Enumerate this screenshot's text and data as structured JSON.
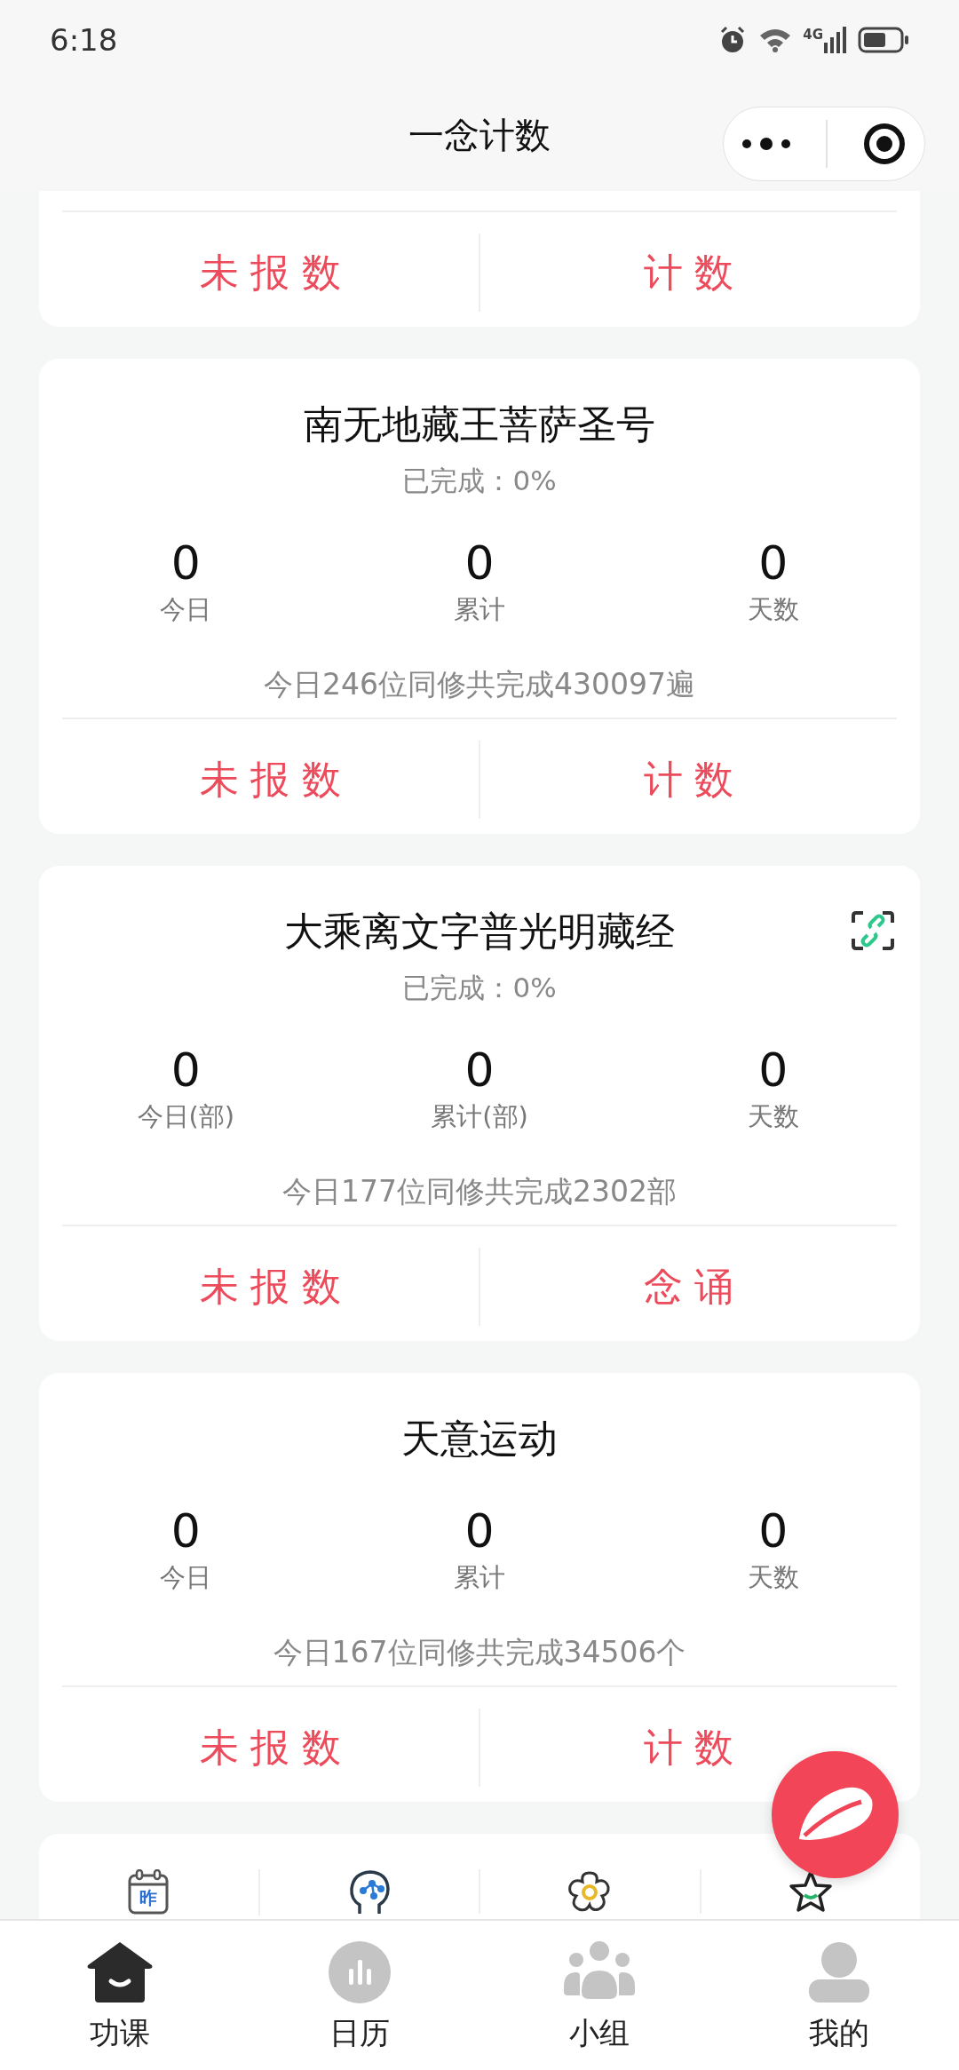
{
  "status_bar": {
    "time": "6:18",
    "network": "4G"
  },
  "header": {
    "title": "一念计数"
  },
  "partial_card": {
    "actions": [
      {
        "label": "未报数"
      },
      {
        "label": "计数"
      }
    ]
  },
  "cards": [
    {
      "title": "南无地藏王菩萨圣号",
      "has_link_icon": false,
      "completed": "已完成：0%",
      "stats": [
        {
          "value": "0",
          "label": "今日"
        },
        {
          "value": "0",
          "label": "累计"
        },
        {
          "value": "0",
          "label": "天数"
        }
      ],
      "community": "今日246位同修共完成430097遍",
      "actions": [
        {
          "label": "未报数"
        },
        {
          "label": "计数"
        }
      ]
    },
    {
      "title": "大乘离文字普光明藏经",
      "has_link_icon": true,
      "completed": "已完成：0%",
      "stats": [
        {
          "value": "0",
          "label": "今日(部)"
        },
        {
          "value": "0",
          "label": "累计(部)"
        },
        {
          "value": "0",
          "label": "天数"
        }
      ],
      "community": "今日177位同修共完成2302部",
      "actions": [
        {
          "label": "未报数"
        },
        {
          "label": "念诵"
        }
      ]
    },
    {
      "title": "天意运动",
      "has_link_icon": false,
      "stats": [
        {
          "value": "0",
          "label": "今日"
        },
        {
          "value": "0",
          "label": "累计"
        },
        {
          "value": "0",
          "label": "天数"
        }
      ],
      "community": "今日167位同修共完成34506个",
      "actions": [
        {
          "label": "未报数"
        },
        {
          "label": "计数"
        }
      ]
    }
  ],
  "quick_actions": [
    {
      "kind": "calendar",
      "icon_text": "昨"
    },
    {
      "kind": "brain"
    },
    {
      "kind": "flower"
    },
    {
      "kind": "star"
    }
  ],
  "tab_bar": [
    {
      "label": "功课",
      "kind": "home",
      "selected": true
    },
    {
      "label": "日历",
      "kind": "chart",
      "selected": false
    },
    {
      "label": "小组",
      "kind": "group",
      "selected": false
    },
    {
      "label": "我的",
      "kind": "person",
      "selected": false
    }
  ]
}
